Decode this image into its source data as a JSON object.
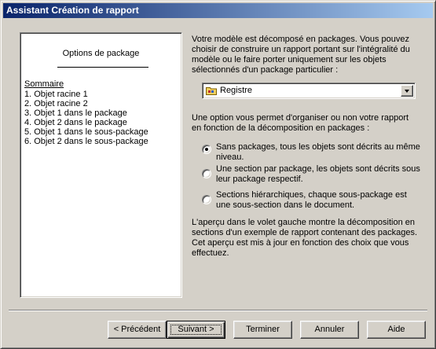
{
  "window": {
    "title": "Assistant Création de rapport"
  },
  "preview": {
    "title": "Options de package",
    "summary": "Sommaire",
    "items": [
      "1. Objet racine 1",
      "2. Objet racine 2",
      "3. Objet 1 dans le package",
      "4. Objet 2 dans le package",
      "5. Objet 1 dans le sous-package",
      "6. Objet 2 dans le sous-package"
    ]
  },
  "intro_text": "Votre modèle est décomposé en packages. Vous pouvez choisir de construire un rapport portant sur l'intégralité du modèle ou le faire porter uniquement sur les objets sélectionnés d'un package particulier :",
  "package_select": {
    "value": "Registre",
    "icon": "folder-package-icon"
  },
  "option_text": "Une option vous permet d'organiser ou non votre rapport en fonction de la décomposition en packages :",
  "radio_options": [
    {
      "label": "Sans packages, tous les objets sont décrits au même niveau.",
      "checked": true
    },
    {
      "label": "Une section par package, les objets sont décrits sous leur package respectif.",
      "checked": false
    },
    {
      "label": "Sections hiérarchiques, chaque sous-package est une sous-section dans le document.",
      "checked": false
    }
  ],
  "preview_note": "L'aperçu dans le volet gauche montre la décomposition en sections d'un exemple de rapport contenant des packages. Cet aperçu est mis à jour en fonction des choix que vous effectuez.",
  "buttons": {
    "previous": "< Précédent",
    "next": "Suivant >",
    "finish": "Terminer",
    "cancel": "Annuler",
    "help": "Aide"
  }
}
